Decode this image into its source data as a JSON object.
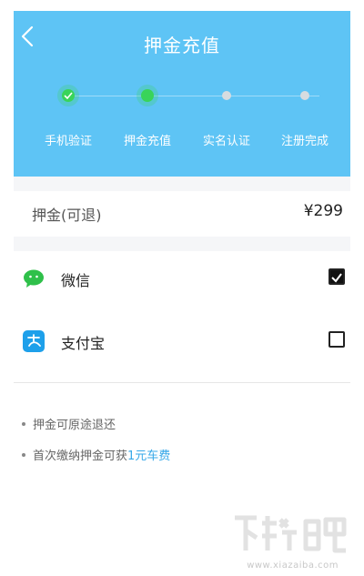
{
  "header": {
    "title": "押金充值",
    "back_icon": "chevron-left-icon",
    "background_color": "#5ec4f5"
  },
  "steps": [
    {
      "label": "手机验证",
      "status": "done"
    },
    {
      "label": "押金充值",
      "status": "done"
    },
    {
      "label": "实名认证",
      "status": "todo"
    },
    {
      "label": "注册完成",
      "status": "todo"
    }
  ],
  "deposit": {
    "label": "押金(可退)",
    "amount": "¥299"
  },
  "payment_methods": [
    {
      "label": "微信",
      "icon": "wechat-icon",
      "checked": true,
      "icon_color": "#2fc04a"
    },
    {
      "label": "支付宝",
      "icon": "alipay-icon",
      "checked": false,
      "icon_color": "#1ea0ea"
    }
  ],
  "notes": {
    "note1": "押金可原途退还",
    "note2_prefix": "首次缴纳押金可获",
    "note2_highlight": "1元车费",
    "highlight_color": "#37a8e8"
  },
  "watermark": {
    "url": "www.xiazaiba.com"
  }
}
